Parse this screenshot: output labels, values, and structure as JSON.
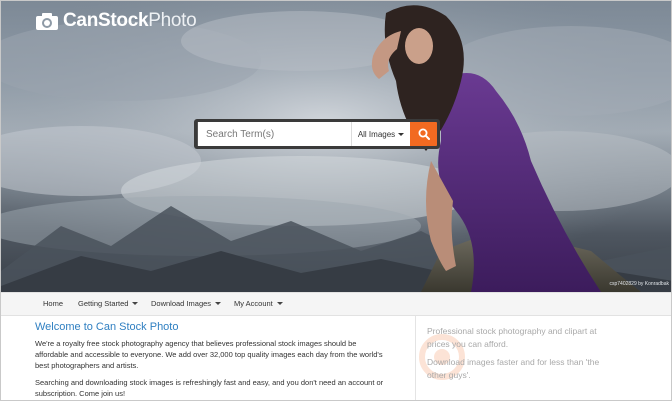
{
  "brand": {
    "name_strong": "CanStock",
    "name_light": "Photo"
  },
  "search": {
    "placeholder": "Search Term(s)",
    "category": "All Images",
    "icon": "search-icon"
  },
  "hero": {
    "credit": "csp7402829 by Konradbak"
  },
  "nav": {
    "items": [
      {
        "label": "Home",
        "has_dropdown": false
      },
      {
        "label": "Getting Started",
        "has_dropdown": true
      },
      {
        "label": "Download Images",
        "has_dropdown": true
      },
      {
        "label": "My Account",
        "has_dropdown": true
      }
    ]
  },
  "content": {
    "title": "Welcome to Can Stock Photo",
    "para1": "We're a royalty free stock photography agency that believes professional stock images should be affordable and accessible to everyone. We add over 32,000 top quality images each day from the world's best photographers and artists.",
    "para2": "Searching and downloading stock images is refreshingly fast and easy, and you don't need an account or subscription. Come join us!",
    "side1": "Professional stock photography and clipart at prices you can afford.",
    "side2": "Download images faster and for less than 'the other guys'."
  },
  "colors": {
    "accent": "#f26a21",
    "link": "#2f7fc1"
  }
}
